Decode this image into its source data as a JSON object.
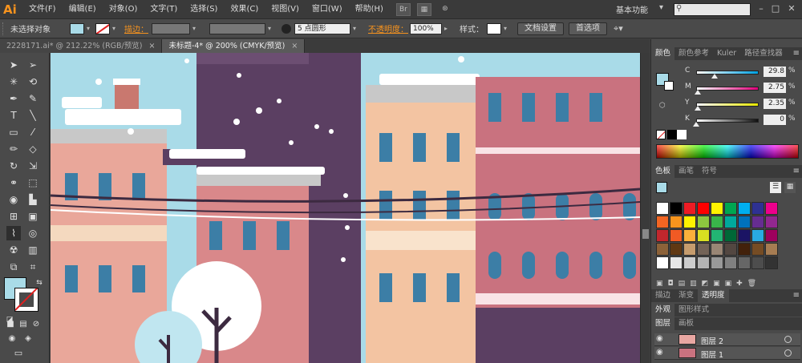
{
  "app": {
    "logo": "Ai"
  },
  "menubar": {
    "items": [
      "文件(F)",
      "编辑(E)",
      "对象(O)",
      "文字(T)",
      "选择(S)",
      "效果(C)",
      "视图(V)",
      "窗口(W)",
      "帮助(H)"
    ],
    "workspace": "基本功能",
    "bridge_icon": "Br"
  },
  "controlbar": {
    "selection": "未选择对象",
    "stroke_label": "描边：",
    "brush": "5 点圆形",
    "opacity_label": "不透明度：",
    "opacity_value": "100%",
    "style_label": "样式：",
    "doc_setup": "文档设置",
    "preferences": "首选项"
  },
  "tabs": [
    {
      "title": "2228171.ai* @ 212.22% (RGB/预览)",
      "close": "×"
    },
    {
      "title": "未标题-4* @ 200% (CMYK/预览)",
      "close": "×"
    }
  ],
  "color_panel": {
    "tabs": [
      "颜色",
      "颜色参考",
      "Kuler",
      "路径查找器"
    ],
    "sliders": [
      {
        "label": "C",
        "value": "29.8",
        "pct": "%",
        "fraction": 0.298,
        "track": "#00a0e0"
      },
      {
        "label": "M",
        "value": "2.75",
        "pct": "%",
        "fraction": 0.0275,
        "track": "#e0007a"
      },
      {
        "label": "Y",
        "value": "2.35",
        "pct": "%",
        "fraction": 0.0235,
        "track": "#e6e600"
      },
      {
        "label": "K",
        "value": "0",
        "pct": "%",
        "fraction": 0.0,
        "track": "#111111"
      }
    ]
  },
  "swatch_panel": {
    "tabs": [
      "色板",
      "画笔",
      "符号"
    ],
    "colors": [
      "#ffffff",
      "#000000",
      "#ed1c24",
      "#ff0000",
      "#fff200",
      "#00a651",
      "#00aeef",
      "#2e3192",
      "#ec008c",
      "#f26522",
      "#f7941d",
      "#fff200",
      "#8dc63f",
      "#39b54a",
      "#00a99d",
      "#0072bc",
      "#662d91",
      "#92278f",
      "#c1272d",
      "#f15a24",
      "#fbb03b",
      "#d9e021",
      "#22b573",
      "#006837",
      "#1b1464",
      "#29abe2",
      "#9e005d",
      "#8c6239",
      "#603813",
      "#c69c6d",
      "#736357",
      "#998675",
      "#534741",
      "#42210b",
      "#754c24",
      "#a67c52",
      "#ffffff",
      "#e6e6e6",
      "#cccccc",
      "#b3b3b3",
      "#999999",
      "#808080",
      "#666666",
      "#4d4d4d",
      "#333333"
    ]
  },
  "bottom_tabs": {
    "row1": [
      "描边",
      "渐变",
      "透明度"
    ],
    "row2": [
      "外观",
      "图形样式"
    ],
    "row3": [
      "图层",
      "画板"
    ]
  },
  "layers": [
    {
      "name": "图层 2"
    },
    {
      "name": "图层 1"
    }
  ]
}
